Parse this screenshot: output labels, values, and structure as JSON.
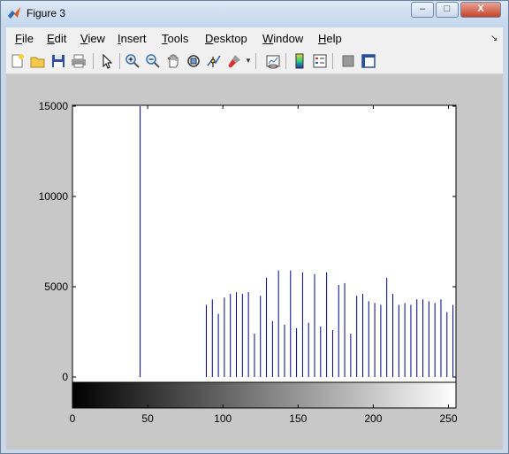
{
  "window": {
    "title": "Figure 3"
  },
  "window_controls": {
    "minimize": "–",
    "maximize": "□",
    "close": "X"
  },
  "menu": [
    {
      "label": "File",
      "mn": "F",
      "rest": "ile"
    },
    {
      "label": "Edit",
      "mn": "E",
      "rest": "dit"
    },
    {
      "label": "View",
      "mn": "V",
      "rest": "iew"
    },
    {
      "label": "Insert",
      "mn": "I",
      "rest": "nsert"
    },
    {
      "label": "Tools",
      "mn": "T",
      "rest": "ools"
    },
    {
      "label": "Desktop",
      "mn": "D",
      "rest": "esktop"
    },
    {
      "label": "Window",
      "mn": "W",
      "rest": "indow"
    },
    {
      "label": "Help",
      "mn": "H",
      "rest": "elp"
    }
  ],
  "toolbar_icons": [
    "new-figure-icon",
    "open-file-icon",
    "save-icon",
    "print-icon",
    "pointer-icon",
    "zoom-in-icon",
    "zoom-out-icon",
    "pan-icon",
    "rotate-3d-icon",
    "data-cursor-icon",
    "brush-icon",
    "link-plot-icon",
    "colorbar-icon",
    "legend-icon",
    "hide-plot-tools-icon",
    "show-plot-tools-icon"
  ],
  "colors": {
    "stem": "#00008b",
    "plot_bg": "#ffffff",
    "figure_bg": "#c8c8c8"
  },
  "chart_data": {
    "type": "bar",
    "title": "",
    "xlabel": "",
    "ylabel": "",
    "xlim": [
      0,
      255
    ],
    "ylim": [
      -1200,
      15000
    ],
    "xticks": [
      0,
      50,
      100,
      150,
      200,
      250
    ],
    "yticks": [
      0,
      5000,
      10000,
      15000
    ],
    "colorbar": "grayscale 0 to 255",
    "x": [
      45,
      89,
      93,
      97,
      101,
      105,
      109,
      113,
      117,
      121,
      125,
      129,
      133,
      137,
      141,
      145,
      149,
      153,
      157,
      161,
      165,
      169,
      173,
      177,
      181,
      185,
      189,
      193,
      197,
      201,
      205,
      209,
      213,
      217,
      221,
      225,
      229,
      233,
      237,
      241,
      245,
      249,
      253
    ],
    "y": [
      15000,
      4000,
      4300,
      3500,
      4400,
      4600,
      4700,
      4600,
      4700,
      2400,
      4500,
      5500,
      3100,
      5900,
      2900,
      5900,
      2700,
      5800,
      3000,
      5700,
      2800,
      5800,
      2600,
      5100,
      5200,
      2400,
      4500,
      4600,
      4200,
      4100,
      4000,
      5500,
      4600,
      4000,
      4100,
      4000,
      4300,
      4300,
      4200,
      4100,
      4300,
      3600,
      4000
    ]
  }
}
